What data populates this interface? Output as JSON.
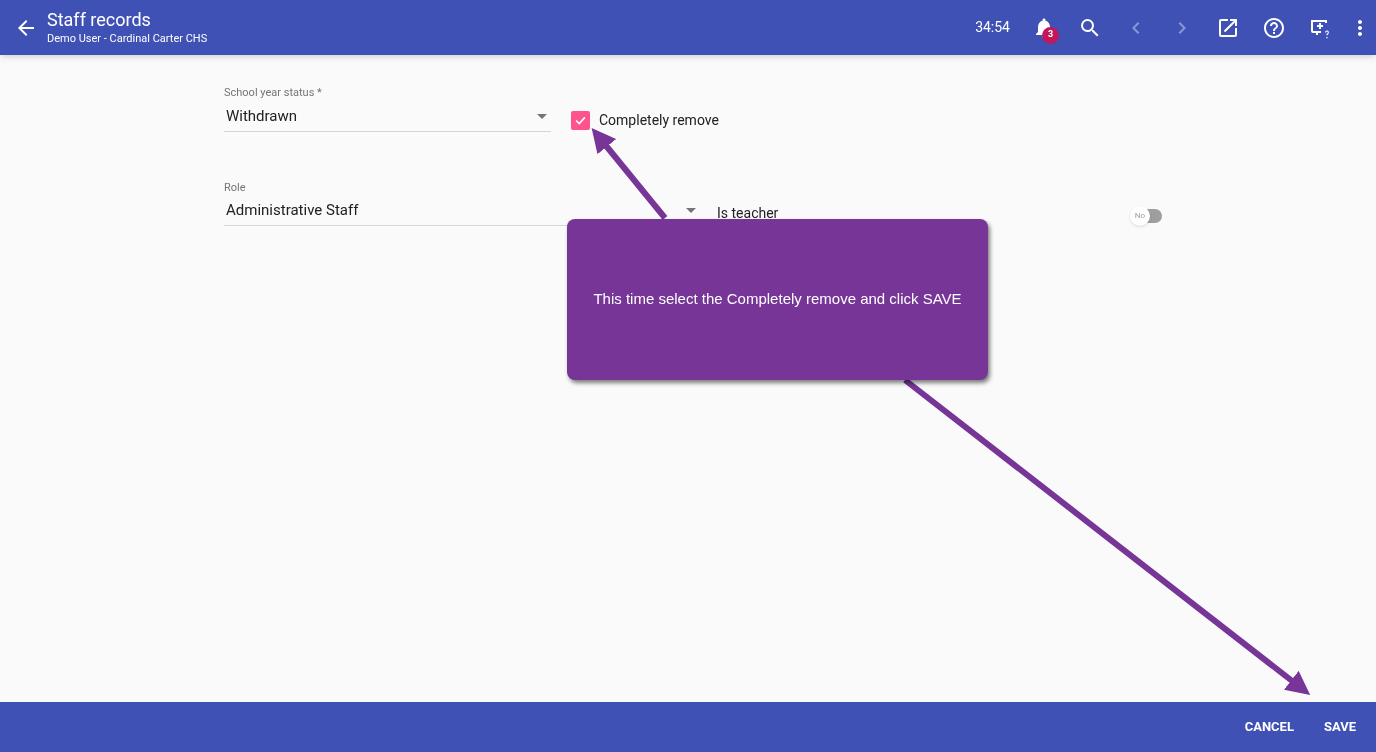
{
  "header": {
    "title": "Staff records",
    "subtitle": "Demo User - Cardinal Carter CHS",
    "timer": "34:54",
    "notification_count": "3",
    "back_enabled": false,
    "forward_enabled": false
  },
  "form": {
    "school_year_status": {
      "label": "School year status *",
      "value": "Withdrawn"
    },
    "completely_remove": {
      "label": "Completely remove",
      "checked": true
    },
    "role": {
      "label": "Role",
      "value": "Administrative Staff"
    },
    "is_teacher": {
      "label": "Is teacher",
      "on": false,
      "toggle_text": "No"
    }
  },
  "callout": {
    "text": "This time select the Completely remove and click SAVE"
  },
  "footer": {
    "buttons": [
      "CANCEL",
      "SAVE"
    ]
  }
}
